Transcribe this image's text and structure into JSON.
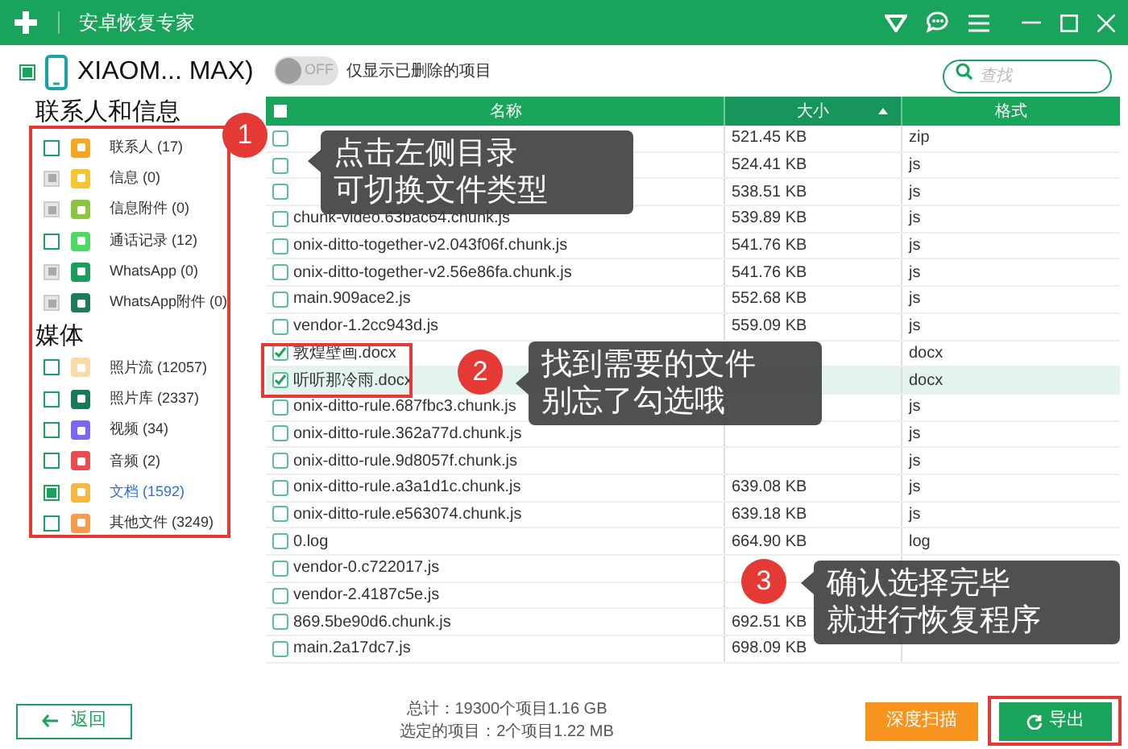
{
  "window": {
    "title": "安卓恢复专家"
  },
  "device": {
    "name": "XIAOM... MAX)",
    "checked": true
  },
  "filter_toggle": {
    "on": false,
    "label": "OFF",
    "text": "仅显示已删除的项目"
  },
  "search": {
    "placeholder": "查找"
  },
  "sidebar": {
    "sections": [
      {
        "title": "联系人和信息",
        "items": [
          {
            "label": "联系人 (17)",
            "checked": false,
            "disabled": false,
            "selected": false,
            "color": "#f5a623"
          },
          {
            "label": "信息 (0)",
            "checked": false,
            "disabled": true,
            "selected": false,
            "color": "#f7c531"
          },
          {
            "label": "信息附件 (0)",
            "checked": false,
            "disabled": true,
            "selected": false,
            "color": "#8cc63f"
          },
          {
            "label": "通话记录 (12)",
            "checked": false,
            "disabled": false,
            "selected": false,
            "color": "#4cd964"
          },
          {
            "label": "WhatsApp (0)",
            "checked": false,
            "disabled": true,
            "selected": false,
            "color": "#1a9e5c"
          },
          {
            "label": "WhatsApp附件 (0)",
            "checked": false,
            "disabled": true,
            "selected": false,
            "color": "#1f7a5a"
          }
        ]
      },
      {
        "title": "媒体",
        "items": [
          {
            "label": "照片流 (12057)",
            "checked": false,
            "disabled": false,
            "selected": false,
            "color": "#f7dca8"
          },
          {
            "label": "照片库 (2337)",
            "checked": false,
            "disabled": false,
            "selected": false,
            "color": "#157a56"
          },
          {
            "label": "视频 (34)",
            "checked": false,
            "disabled": false,
            "selected": false,
            "color": "#7b68ee"
          },
          {
            "label": "音频 (2)",
            "checked": false,
            "disabled": false,
            "selected": false,
            "color": "#e84c4c"
          },
          {
            "label": "文档 (1592)",
            "checked": true,
            "disabled": false,
            "selected": true,
            "color": "#f5b942"
          },
          {
            "label": "其他文件 (3249)",
            "checked": false,
            "disabled": false,
            "selected": false,
            "color": "#f39c4a"
          }
        ]
      }
    ]
  },
  "table": {
    "all_checked": false,
    "columns": [
      {
        "label": "名称",
        "sorted": false
      },
      {
        "label": "大小",
        "sorted": true
      },
      {
        "label": "格式",
        "sorted": false
      }
    ],
    "rows": [
      {
        "size": "521.45 KB",
        "format": "zip",
        "checked": false,
        "selected": false
      },
      {
        "size": "524.41 KB",
        "format": "js",
        "checked": false,
        "selected": false
      },
      {
        "size": "538.51 KB",
        "format": "js",
        "checked": false,
        "selected": false
      },
      {
        "name": "chunk-video.63bac64.chunk.js",
        "size": "539.89 KB",
        "format": "js",
        "checked": false,
        "selected": false
      },
      {
        "name": "onix-ditto-together-v2.043f06f.chunk.js",
        "size": "541.76 KB",
        "format": "js",
        "checked": false,
        "selected": false
      },
      {
        "name": "onix-ditto-together-v2.56e86fa.chunk.js",
        "size": "541.76 KB",
        "format": "js",
        "checked": false,
        "selected": false
      },
      {
        "name": "main.909ace2.js",
        "size": "552.68 KB",
        "format": "js",
        "checked": false,
        "selected": false
      },
      {
        "name": "vendor-1.2cc943d.js",
        "size": "559.09 KB",
        "format": "js",
        "checked": false,
        "selected": false
      },
      {
        "name": "敦煌壁画.docx",
        "format": "docx",
        "checked": true,
        "selected": false
      },
      {
        "name": "听听那冷雨.docx",
        "format": "docx",
        "checked": true,
        "selected": true
      },
      {
        "name": "onix-ditto-rule.687fbc3.chunk.js",
        "format": "js",
        "checked": false,
        "selected": false
      },
      {
        "name": "onix-ditto-rule.362a77d.chunk.js",
        "format": "js",
        "checked": false,
        "selected": false
      },
      {
        "name": "onix-ditto-rule.9d8057f.chunk.js",
        "format": "js",
        "checked": false,
        "selected": false
      },
      {
        "name": "onix-ditto-rule.a3a1d1c.chunk.js",
        "size": "639.08 KB",
        "format": "js",
        "checked": false,
        "selected": false
      },
      {
        "name": "onix-ditto-rule.e563074.chunk.js",
        "size": "639.18 KB",
        "format": "js",
        "checked": false,
        "selected": false
      },
      {
        "name": "0.log",
        "size": "664.90 KB",
        "format": "log",
        "checked": false,
        "selected": false
      },
      {
        "name": "vendor-0.c722017.js",
        "checked": false,
        "selected": false
      },
      {
        "name": "vendor-2.4187c5e.js",
        "checked": false,
        "selected": false
      },
      {
        "name": "869.5be90d6.chunk.js",
        "size": "692.51 KB",
        "checked": false,
        "selected": false
      },
      {
        "name": "main.2a17dc7.js",
        "size": "698.09 KB",
        "checked": false,
        "selected": false
      }
    ]
  },
  "callouts": [
    {
      "number": "1",
      "lines": [
        "点击左侧目录",
        "可切换文件类型"
      ]
    },
    {
      "number": "2",
      "lines": [
        "找到需要的文件",
        "别忘了勾选哦"
      ]
    },
    {
      "number": "3",
      "lines": [
        "确认选择完毕",
        "就进行恢复程序"
      ]
    }
  ],
  "footer": {
    "back": "返回",
    "total": "总计：19300个项目1.16 GB",
    "selected_total": "选定的项目：2个项目1.22 MB",
    "buttons": [
      {
        "label": "深度扫描",
        "kind": "scan"
      },
      {
        "label": "导出",
        "kind": "export"
      }
    ]
  }
}
